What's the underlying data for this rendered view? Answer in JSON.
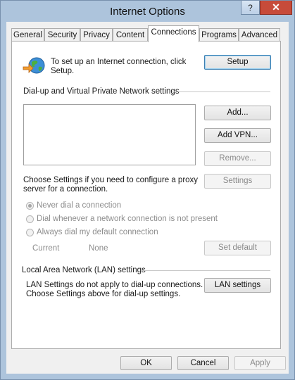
{
  "window": {
    "title": "Internet Options",
    "help_glyph": "?",
    "close_glyph": "✕"
  },
  "tabs": [
    {
      "label": "General"
    },
    {
      "label": "Security"
    },
    {
      "label": "Privacy"
    },
    {
      "label": "Content"
    },
    {
      "label": "Connections",
      "active": true
    },
    {
      "label": "Programs"
    },
    {
      "label": "Advanced"
    }
  ],
  "setup": {
    "text_line1": "To set up an Internet connection, click",
    "text_line2": "Setup.",
    "button": "Setup",
    "icon": "globe-network-icon"
  },
  "dialup": {
    "heading": "Dial-up and Virtual Private Network settings",
    "add": "Add...",
    "add_vpn": "Add VPN...",
    "remove": "Remove...",
    "settings_text_line1": "Choose Settings if you need to configure a proxy",
    "settings_text_line2": "server for a connection.",
    "settings": "Settings",
    "radios": [
      {
        "label": "Never dial a connection",
        "checked": true
      },
      {
        "label": "Dial whenever a network connection is not present",
        "checked": false
      },
      {
        "label": "Always dial my default connection",
        "checked": false
      }
    ],
    "current_label": "Current",
    "current_value": "None",
    "set_default": "Set default"
  },
  "lan": {
    "heading": "Local Area Network (LAN) settings",
    "text_line1": "LAN Settings do not apply to dial-up connections.",
    "text_line2": "Choose Settings above for dial-up settings.",
    "button": "LAN settings"
  },
  "footer": {
    "ok": "OK",
    "cancel": "Cancel",
    "apply": "Apply"
  }
}
